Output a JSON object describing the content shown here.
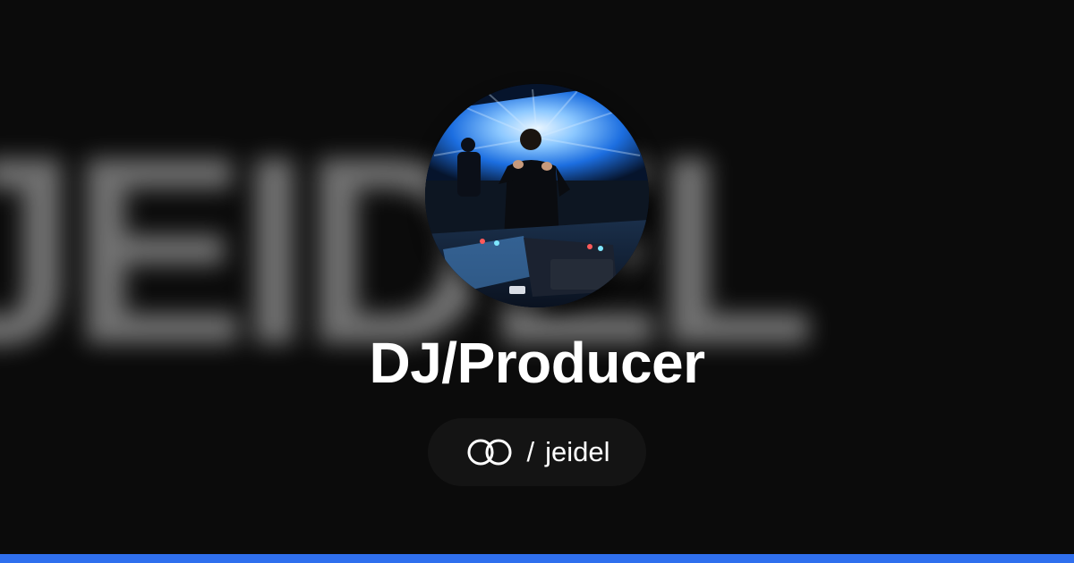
{
  "background": {
    "wordmark": "jeidel"
  },
  "profile": {
    "avatar": "avatar-photo",
    "title": "DJ/Producer",
    "handle_separator": "/",
    "handle": "jeidel"
  },
  "brand": {
    "icon": "linked-rings-icon",
    "accent_color": "#2f6fee"
  }
}
